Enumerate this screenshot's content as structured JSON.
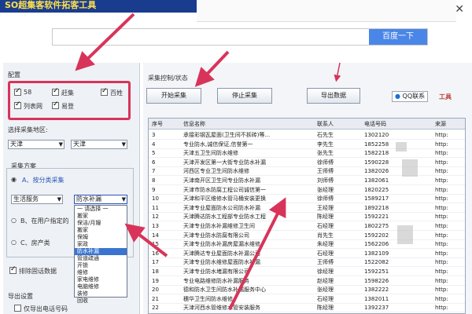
{
  "banner": {
    "title": "SO超集客软件拓客工具"
  },
  "search": {
    "placeholder": "",
    "button": "百度一下"
  },
  "config": {
    "title": "配置",
    "options": [
      {
        "label": "58",
        "checked": true
      },
      {
        "label": "赶集",
        "checked": true
      },
      {
        "label": "百姓",
        "checked": true
      },
      {
        "label": "列表网",
        "checked": true
      },
      {
        "label": "易登",
        "checked": true
      }
    ]
  },
  "region": {
    "label": "选择采集地区:",
    "province": "天津",
    "city": "天津"
  },
  "scheme": {
    "title": "采集方案",
    "option_a": "A、按分类采集",
    "category": "生活服务",
    "subcategory": "防水补漏",
    "option_b": "B、在用户指定的",
    "option_c": "C、房产类"
  },
  "dropdown_items": [
    "一 请选择 一",
    "搬家",
    "保洁/月嫂",
    "搬家",
    "保姆",
    "家政",
    "防水补漏",
    "管道疏通",
    "开锁",
    "维修",
    "家电维修",
    "电脑维修",
    "装修",
    "回收"
  ],
  "dropdown_selected_index": 6,
  "dedupe": {
    "label": "排除固话数据",
    "checked": true
  },
  "export": {
    "title": "导出设置",
    "only_phone": "仅导出电话号码",
    "checked": false
  },
  "controls": {
    "title": "采集控制/状态",
    "start": "开始采集",
    "stop": "停止采集",
    "export": "导出数据",
    "qq": "QQ联系",
    "tools": "工具"
  },
  "table": {
    "headers": [
      "序号",
      "信息名称",
      "联系人",
      "电话号码",
      "来源"
    ],
    "rows": [
      [
        "3",
        "承接彩钢瓦屋面(卫生间不拆砖)等...",
        "石先生",
        "1302120",
        "http:"
      ],
      [
        "4",
        "专业防水,诚信保证,信誉第一",
        "李先生",
        "1852258",
        "http:"
      ],
      [
        "5",
        "天津五卫生间防水维修",
        "张先生",
        "1582218",
        "http:"
      ],
      [
        "6",
        "天津开发区第一大街专业防水补漏",
        "徐师傅",
        "1590228",
        "http:"
      ],
      [
        "7",
        "河西区专业卫生间防水维修",
        "王师傅",
        "1382026",
        "http:"
      ],
      [
        "8",
        "天津南开区卫生间专业防水补漏",
        "刘师傅",
        "1382061",
        "http:"
      ],
      [
        "9",
        "天津市防水防腐工程公司诚信第一",
        "张经理",
        "1820225",
        "http:"
      ],
      [
        "10",
        "天津和平区维修水管马桶安装更换",
        "徐师傅",
        "1589217",
        "http:"
      ],
      [
        "11",
        "天津专业屋面防水公司防水补漏",
        "王经理",
        "1892218",
        "http:"
      ],
      [
        "12",
        "天津腾达防水工程部专业防水工程",
        "陈经理",
        "1592221",
        "http:"
      ],
      [
        "13",
        "天津专业防水补漏维修卫生间",
        "石经理",
        "1802275",
        "http:"
      ],
      [
        "14",
        "天津专业防水防腐有限公司",
        "肖先生",
        "1592202",
        "http:"
      ],
      [
        "15",
        "天津专业防水补漏房屋漏水维修",
        "朱经理",
        "1562206",
        "http:"
      ],
      [
        "16",
        "天津腾达专业屋面防水补漏公司",
        "石经理",
        "1382109",
        "http:"
      ],
      [
        "17",
        "天津专业防水维修屋面防水补漏",
        "王师傅",
        "1522082",
        "http:"
      ],
      [
        "18",
        "天津专业防水堵漏有限公司",
        "徐经理",
        "1592251",
        "http:"
      ],
      [
        "19",
        "专业电路维修防水补漏服务",
        "赵经理",
        "1598226",
        "http:"
      ],
      [
        "20",
        "德和防水卫生间防水补漏服务中心",
        "张经理",
        "1382222",
        "http:"
      ],
      [
        "21",
        "穗华卫生间防水维修",
        "石经理",
        "1382011",
        "http:"
      ],
      [
        "22",
        "天津河西水管维修水管安装服务",
        "陈经理",
        "1392237",
        "http:"
      ]
    ]
  },
  "colors": {
    "highlight": "#d8345a",
    "banner_bg": "#1a3c8f",
    "search_button": "#4a86e8"
  },
  "icons": {
    "qq": "qq-penguin-icon",
    "close": "close-icon"
  }
}
